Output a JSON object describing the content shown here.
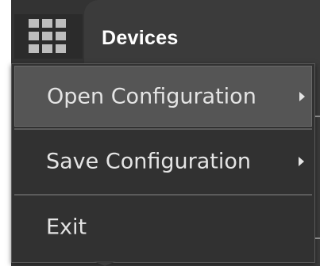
{
  "header": {
    "title": "Devices",
    "menu_icon": "grid-icon"
  },
  "menu": {
    "items": [
      {
        "label": "Open Configuration",
        "has_submenu": true,
        "highlighted": true
      },
      {
        "label": "Save Configuration",
        "has_submenu": true,
        "highlighted": false
      },
      {
        "label": "Exit",
        "has_submenu": false,
        "highlighted": false
      }
    ]
  },
  "colors": {
    "menu_background": "#313131",
    "highlight": "#555555",
    "text": "#e4e4e4",
    "header_text": "#ffffff"
  }
}
